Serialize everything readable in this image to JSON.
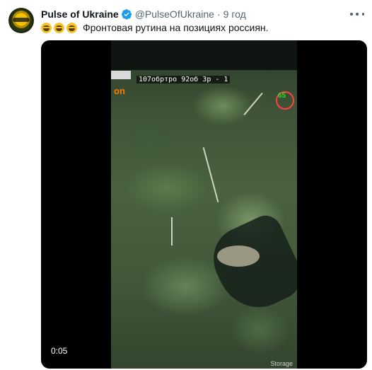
{
  "tweet": {
    "author_name": "Pulse of Ukraine",
    "handle": "@PulseOfUkraine",
    "separator": "·",
    "time": "9 год",
    "message": "Фронтовая рутина на позициях россиян."
  },
  "video": {
    "overlay_label": "107обртро 92об 3р - 1",
    "overlay_word": "on",
    "gauge_value": "65",
    "watermark": "Storage",
    "duration": "0:05"
  },
  "colors": {
    "verified": "#1d9bf0",
    "secondary_text": "#536471",
    "overlay_orange": "#ff7a00"
  },
  "icons": {
    "verified": "verified-badge-icon",
    "more": "more-options-icon",
    "emoji": "grinning-face-emoji"
  }
}
